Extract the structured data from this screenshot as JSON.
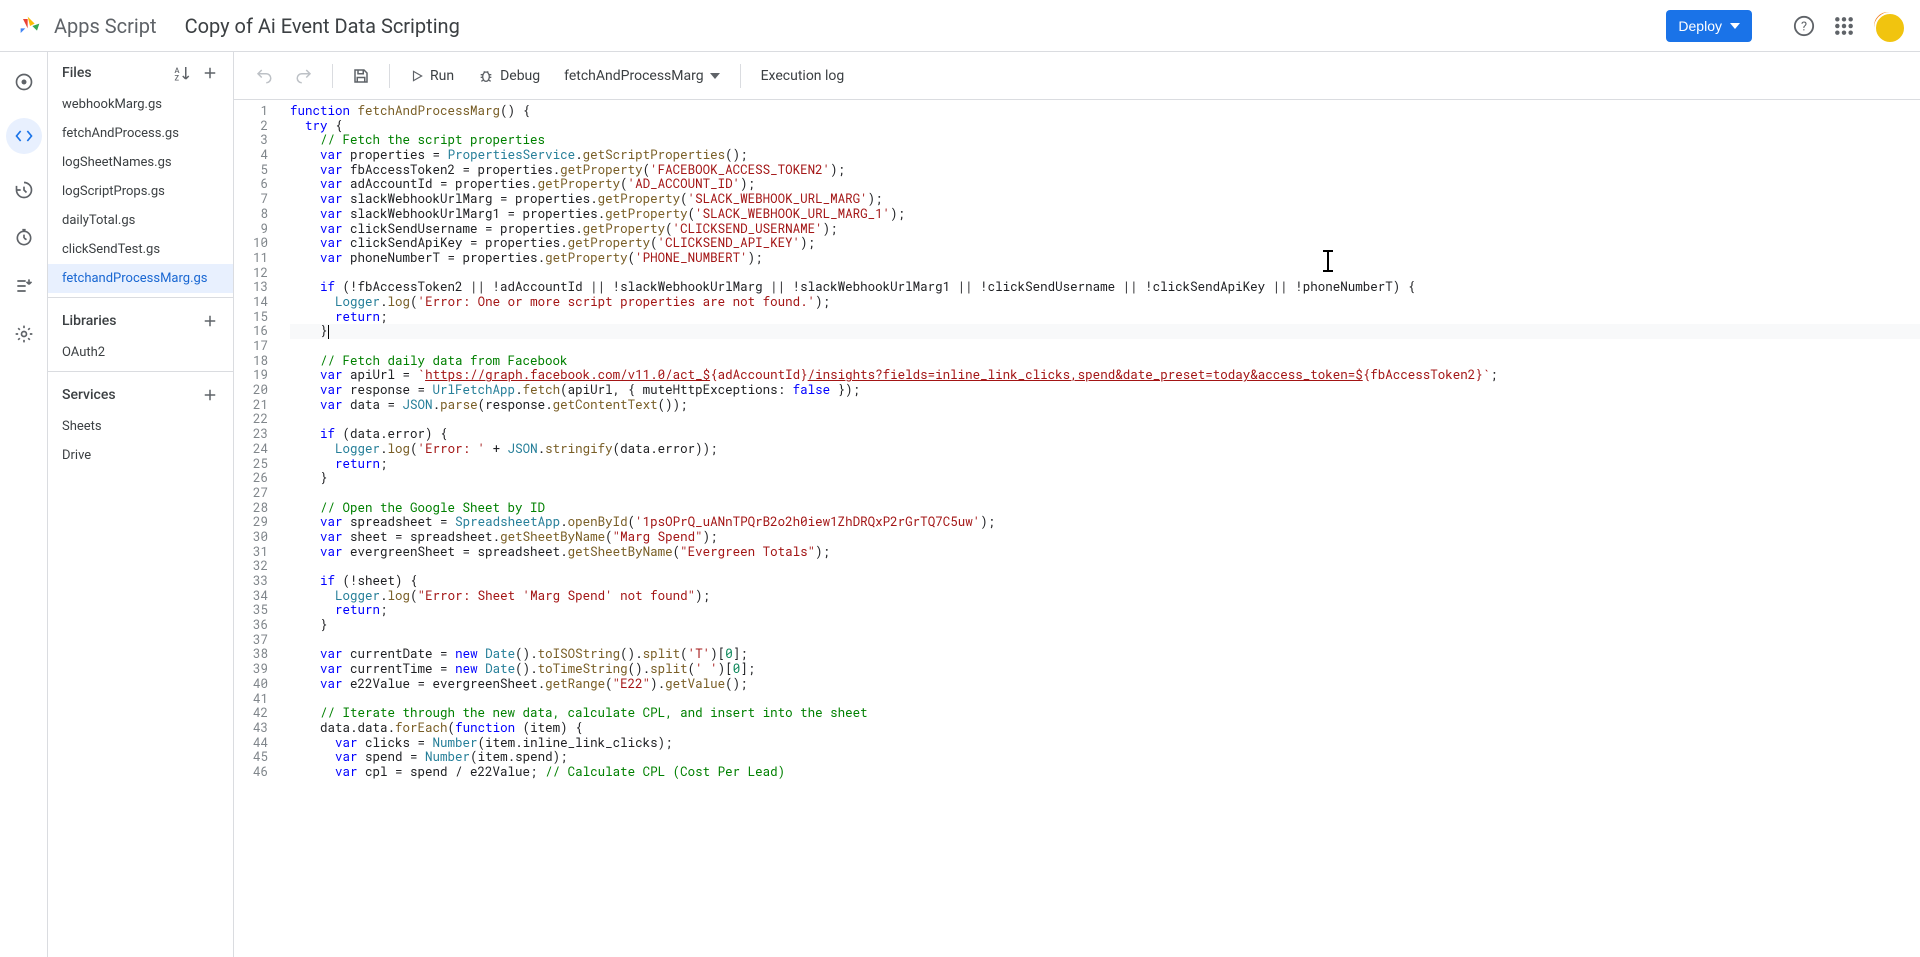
{
  "header": {
    "app_name": "Apps Script",
    "project_title": "Copy of Ai Event Data Scripting",
    "deploy_label": "Deploy"
  },
  "sidebar": {
    "files_label": "Files",
    "libraries_label": "Libraries",
    "services_label": "Services",
    "files": [
      "webhookMarg.gs",
      "fetchAndProcess.gs",
      "logSheetNames.gs",
      "logScriptProps.gs",
      "dailyTotal.gs",
      "clickSendTest.gs",
      "fetchandProcessMarg.gs"
    ],
    "libraries": [
      "OAuth2"
    ],
    "services": [
      "Sheets",
      "Drive"
    ]
  },
  "toolbar": {
    "run_label": "Run",
    "debug_label": "Debug",
    "fn_selected": "fetchAndProcessMarg",
    "exec_log_label": "Execution log"
  },
  "code_lines": [
    {
      "n": 1,
      "h": "<span class='kw'>function</span> <span class='fn'>fetchAndProcessMarg</span>() {"
    },
    {
      "n": 2,
      "h": "  <span class='kw'>try</span> {"
    },
    {
      "n": 3,
      "h": "    <span class='com'>// Fetch the script properties</span>"
    },
    {
      "n": 4,
      "h": "    <span class='kw'>var</span> properties = <span class='cls'>PropertiesService</span>.<span class='fn'>getScriptProperties</span>();"
    },
    {
      "n": 5,
      "h": "    <span class='kw'>var</span> fbAccessToken2 = properties.<span class='fn'>getProperty</span>(<span class='str'>'FACEBOOK_ACCESS_TOKEN2'</span>);"
    },
    {
      "n": 6,
      "h": "    <span class='kw'>var</span> adAccountId = properties.<span class='fn'>getProperty</span>(<span class='str'>'AD_ACCOUNT_ID'</span>);"
    },
    {
      "n": 7,
      "h": "    <span class='kw'>var</span> slackWebhookUrlMarg = properties.<span class='fn'>getProperty</span>(<span class='str'>'SLACK_WEBHOOK_URL_MARG'</span>);"
    },
    {
      "n": 8,
      "h": "    <span class='kw'>var</span> slackWebhookUrlMarg1 = properties.<span class='fn'>getProperty</span>(<span class='str'>'SLACK_WEBHOOK_URL_MARG_1'</span>);"
    },
    {
      "n": 9,
      "h": "    <span class='kw'>var</span> clickSendUsername = properties.<span class='fn'>getProperty</span>(<span class='str'>'CLICKSEND_USERNAME'</span>);"
    },
    {
      "n": 10,
      "h": "    <span class='kw'>var</span> clickSendApiKey = properties.<span class='fn'>getProperty</span>(<span class='str'>'CLICKSEND_API_KEY'</span>);"
    },
    {
      "n": 11,
      "h": "    <span class='kw'>var</span> phoneNumberT = properties.<span class='fn'>getProperty</span>(<span class='str'>'PHONE_NUMBERT'</span>);"
    },
    {
      "n": 12,
      "h": ""
    },
    {
      "n": 13,
      "h": "    <span class='kw'>if</span> (!fbAccessToken2 || !adAccountId || !slackWebhookUrlMarg || !slackWebhookUrlMarg1 || !clickSendUsername || !clickSendApiKey || !phoneNumberT) {"
    },
    {
      "n": 14,
      "h": "      <span class='cls'>Logger</span>.<span class='fn'>log</span>(<span class='str'>'Error: One or more script properties are not found.'</span>);"
    },
    {
      "n": 15,
      "h": "      <span class='kw'>return</span>;"
    },
    {
      "n": 16,
      "h": "    }<span class='cursor-blink'></span>",
      "current": true
    },
    {
      "n": 17,
      "h": ""
    },
    {
      "n": 18,
      "h": "    <span class='com'>// Fetch daily data from Facebook</span>"
    },
    {
      "n": 19,
      "h": "    <span class='kw'>var</span> apiUrl = <span class='str'>`<span class='url'>https://graph.facebook.com/v11.0/act_$</span>{adAccountId}<span class='url'>/insights?fields=inline_link_clicks,spend&date_preset=today&access_token=$</span>{fbAccessToken2}`</span>;"
    },
    {
      "n": 20,
      "h": "    <span class='kw'>var</span> response = <span class='cls'>UrlFetchApp</span>.<span class='fn'>fetch</span>(apiUrl, { muteHttpExceptions: <span class='kw'>false</span> });"
    },
    {
      "n": 21,
      "h": "    <span class='kw'>var</span> data = <span class='cls'>JSON</span>.<span class='fn'>parse</span>(response.<span class='fn'>getContentText</span>());"
    },
    {
      "n": 22,
      "h": ""
    },
    {
      "n": 23,
      "h": "    <span class='kw'>if</span> (data.error) {"
    },
    {
      "n": 24,
      "h": "      <span class='cls'>Logger</span>.<span class='fn'>log</span>(<span class='str'>'Error: '</span> + <span class='cls'>JSON</span>.<span class='fn'>stringify</span>(data.error));"
    },
    {
      "n": 25,
      "h": "      <span class='kw'>return</span>;"
    },
    {
      "n": 26,
      "h": "    }"
    },
    {
      "n": 27,
      "h": ""
    },
    {
      "n": 28,
      "h": "    <span class='com'>// Open the Google Sheet by ID</span>"
    },
    {
      "n": 29,
      "h": "    <span class='kw'>var</span> spreadsheet = <span class='cls'>SpreadsheetApp</span>.<span class='fn'>openById</span>(<span class='str'>'1psOPrQ_uANnTPQrB2o2h0iew1ZhDRQxP2rGrTQ7C5uw'</span>);"
    },
    {
      "n": 30,
      "h": "    <span class='kw'>var</span> sheet = spreadsheet.<span class='fn'>getSheetByName</span>(<span class='str'>\"Marg Spend\"</span>);"
    },
    {
      "n": 31,
      "h": "    <span class='kw'>var</span> evergreenSheet = spreadsheet.<span class='fn'>getSheetByName</span>(<span class='str'>\"Evergreen Totals\"</span>);"
    },
    {
      "n": 32,
      "h": ""
    },
    {
      "n": 33,
      "h": "    <span class='kw'>if</span> (!sheet) {"
    },
    {
      "n": 34,
      "h": "      <span class='cls'>Logger</span>.<span class='fn'>log</span>(<span class='str'>\"Error: Sheet 'Marg Spend' not found\"</span>);"
    },
    {
      "n": 35,
      "h": "      <span class='kw'>return</span>;"
    },
    {
      "n": 36,
      "h": "    }"
    },
    {
      "n": 37,
      "h": ""
    },
    {
      "n": 38,
      "h": "    <span class='kw'>var</span> currentDate = <span class='kw'>new</span> <span class='cls'>Date</span>().<span class='fn'>toISOString</span>().<span class='fn'>split</span>(<span class='str'>'T'</span>)[<span class='num'>0</span>];"
    },
    {
      "n": 39,
      "h": "    <span class='kw'>var</span> currentTime = <span class='kw'>new</span> <span class='cls'>Date</span>().<span class='fn'>toTimeString</span>().<span class='fn'>split</span>(<span class='str'>' '</span>)[<span class='num'>0</span>];"
    },
    {
      "n": 40,
      "h": "    <span class='kw'>var</span> e22Value = evergreenSheet.<span class='fn'>getRange</span>(<span class='str'>\"E22\"</span>).<span class='fn'>getValue</span>();"
    },
    {
      "n": 41,
      "h": ""
    },
    {
      "n": 42,
      "h": "    <span class='com'>// Iterate through the new data, calculate CPL, and insert into the sheet</span>"
    },
    {
      "n": 43,
      "h": "    data.data.<span class='fn'>forEach</span>(<span class='kw'>function</span> (item) {"
    },
    {
      "n": 44,
      "h": "      <span class='kw'>var</span> clicks = <span class='cls'>Number</span>(item.inline_link_clicks);"
    },
    {
      "n": 45,
      "h": "      <span class='kw'>var</span> spend = <span class='cls'>Number</span>(item.spend);"
    },
    {
      "n": 46,
      "h": "      <span class='kw'>var</span> cpl = spend / e22Value; <span class='com'>// Calculate CPL (Cost Per Lead)</span>"
    }
  ]
}
